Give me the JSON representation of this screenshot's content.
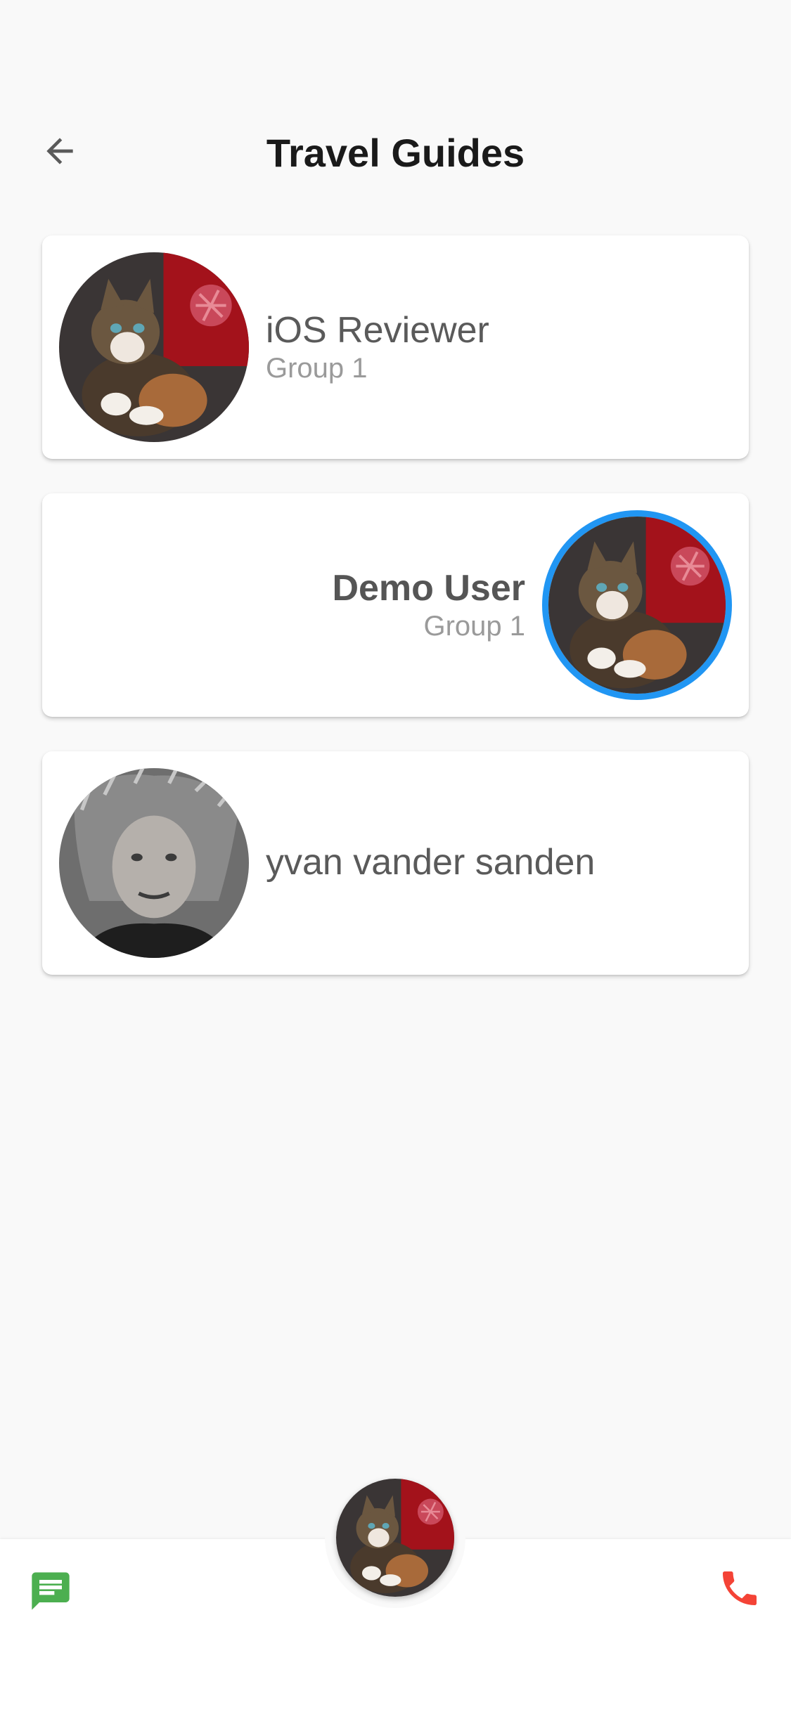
{
  "header": {
    "title": "Travel Guides",
    "back_icon": "arrow-left-icon"
  },
  "contacts": [
    {
      "name": "iOS Reviewer",
      "group": "Group 1",
      "avatar": "cat-photo"
    },
    {
      "name": "Demo User",
      "group": "Group 1",
      "avatar": "cat-photo",
      "current_user": true,
      "accent": "#2196f3"
    },
    {
      "name": "yvan vander sanden",
      "group": "",
      "avatar": "man-photo"
    }
  ],
  "bottom_bar": {
    "message_icon": "message-icon",
    "message_color": "#4caf50",
    "call_icon": "phone-icon",
    "call_color": "#f44336",
    "center_avatar": "cat-photo"
  }
}
